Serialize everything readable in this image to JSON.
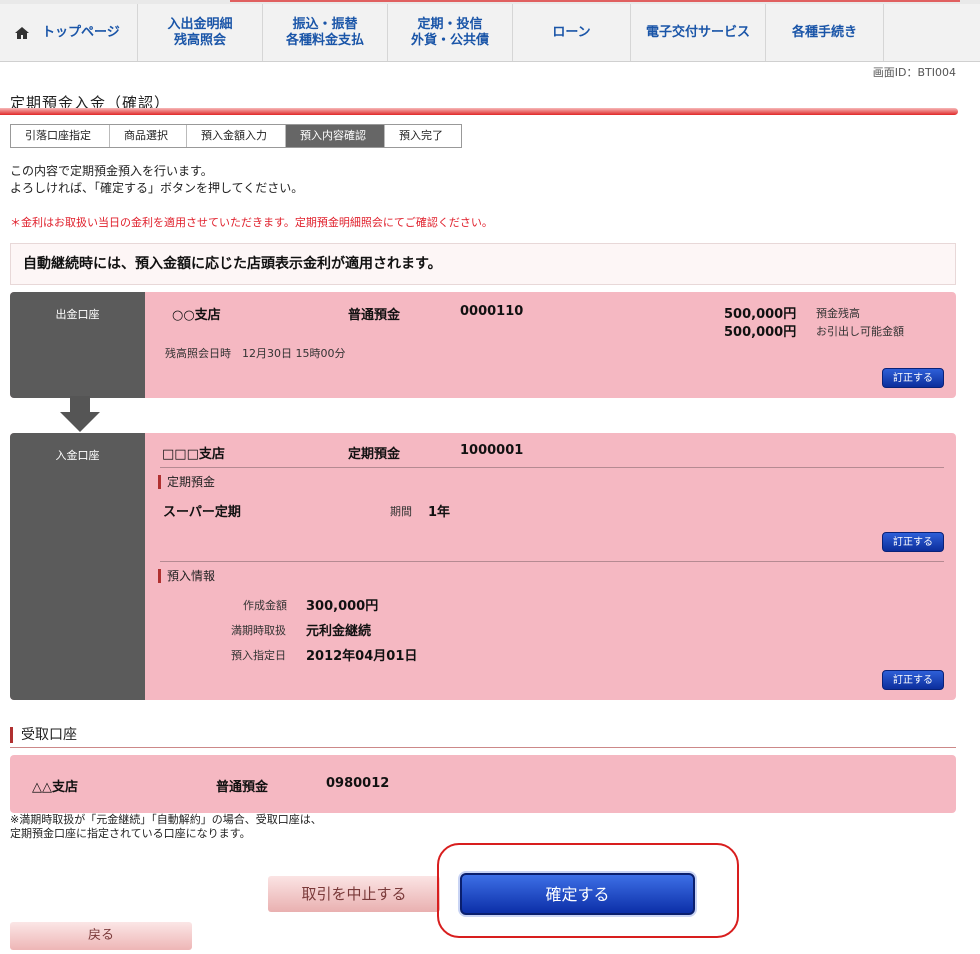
{
  "nav": {
    "home": "トップページ",
    "items": [
      {
        "line1": "入出金明細",
        "line2": "残高照会"
      },
      {
        "line1": "振込・振替",
        "line2": "各種料金支払"
      },
      {
        "line1": "定期・投信",
        "line2": "外貨・公共債"
      },
      {
        "line1": "ローン",
        "line2": ""
      },
      {
        "line1": "電子交付サービス",
        "line2": ""
      },
      {
        "line1": "各種手続き",
        "line2": ""
      }
    ]
  },
  "screen_id": "画面ID：BTI004",
  "page_title": "定期預金入金（確認）",
  "steps": [
    "引落口座指定",
    "商品選択",
    "預入金額入力",
    "預入内容確認",
    "預入完了"
  ],
  "active_step": "預入内容確認",
  "intro": {
    "line1": "この内容で定期預金預入を行います。",
    "line2": "よろしければ、「確定する」ボタンを押してください。"
  },
  "notice": "＊金利はお取扱い当日の金利を適用させていただきます。定期預金明細照会にてご確認ください。",
  "banner": "自動継続時には、預入金額に応じた店頭表示金利が適用されます。",
  "withdrawal": {
    "label": "出金口座",
    "branch": "○○支店",
    "type": "普通預金",
    "number": "0000110",
    "balance": "500,000円",
    "balance_label": "預金残高",
    "available": "500,000円",
    "available_label": "お引出し可能金額",
    "inquiry": "残高照会日時　12月30日 15時00分",
    "correct": "訂正する"
  },
  "deposit": {
    "label": "入金口座",
    "branch": "□□□支店",
    "type": "定期預金",
    "number": "1000001",
    "product_section": "定期預金",
    "product": "スーパー定期",
    "term_label": "期間",
    "term": "1年",
    "correct1": "訂正する",
    "info_section": "預入情報",
    "amount_label": "作成金額",
    "amount": "300,000円",
    "maturity_label": "満期時取扱",
    "maturity": "元利金継続",
    "date_label": "預入指定日",
    "date": "2012年04月01日",
    "correct2": "訂正する"
  },
  "receive": {
    "heading": "受取口座",
    "branch": "△△支店",
    "type": "普通預金",
    "number": "0980012"
  },
  "footnote": {
    "line1": "※満期時取扱が「元金継続」「自動解約」の場合、受取口座は、",
    "line2": "定期預金口座に指定されている口座になります。"
  },
  "buttons": {
    "cancel": "取引を中止する",
    "confirm": "確定する",
    "back": "戻る"
  },
  "colors": {
    "accent_red": "#e02828",
    "panel_pink": "#f5b8c2",
    "label_gray": "#5b5b5b",
    "button_blue": "#0c2fa8"
  }
}
